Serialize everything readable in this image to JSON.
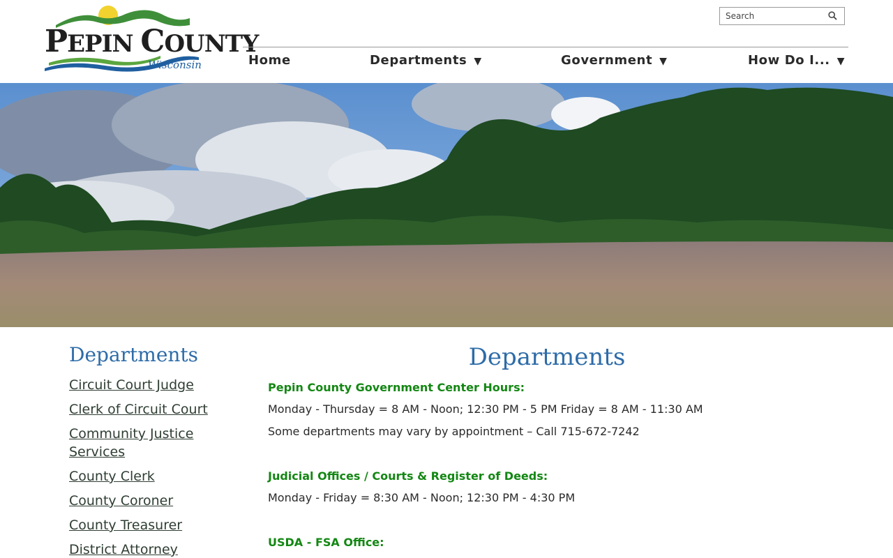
{
  "logo": {
    "title_big1": "P",
    "title_small1": "EPIN ",
    "title_big2": "C",
    "title_small2": "OUNTY",
    "subtitle": "Wisconsin"
  },
  "search": {
    "placeholder": "Search"
  },
  "nav": {
    "items": [
      {
        "label": "Home",
        "has_dropdown": false
      },
      {
        "label": "Departments",
        "has_dropdown": true
      },
      {
        "label": "Government",
        "has_dropdown": true
      },
      {
        "label": "How Do I...",
        "has_dropdown": true
      }
    ],
    "dropdown_arrow": "▼"
  },
  "sidebar": {
    "title": "Departments",
    "items": [
      "Circuit Court Judge",
      "Clerk of Circuit Court",
      "Community Justice Services",
      "County Clerk",
      "County Coroner",
      "County Treasurer",
      "District Attorney"
    ]
  },
  "main": {
    "title": "Departments",
    "sections": [
      {
        "heading": "Pepin County Government Center Hours:",
        "lines": [
          "Monday - Thursday = 8 AM - Noon; 12:30 PM - 5 PM Friday = 8 AM - 11:30 AM",
          "Some departments may vary by appointment – Call 715-672-7242"
        ]
      },
      {
        "heading": "Judicial Offices / Courts & Register of Deeds:",
        "lines": [
          "Monday - Friday = 8:30 AM - Noon; 12:30 PM - 4:30 PM"
        ]
      },
      {
        "heading": "USDA - FSA Office:",
        "lines": []
      }
    ]
  },
  "colors": {
    "heading_blue": "#2e6ca8",
    "section_green": "#138713",
    "link_dark": "#2f3e33"
  }
}
